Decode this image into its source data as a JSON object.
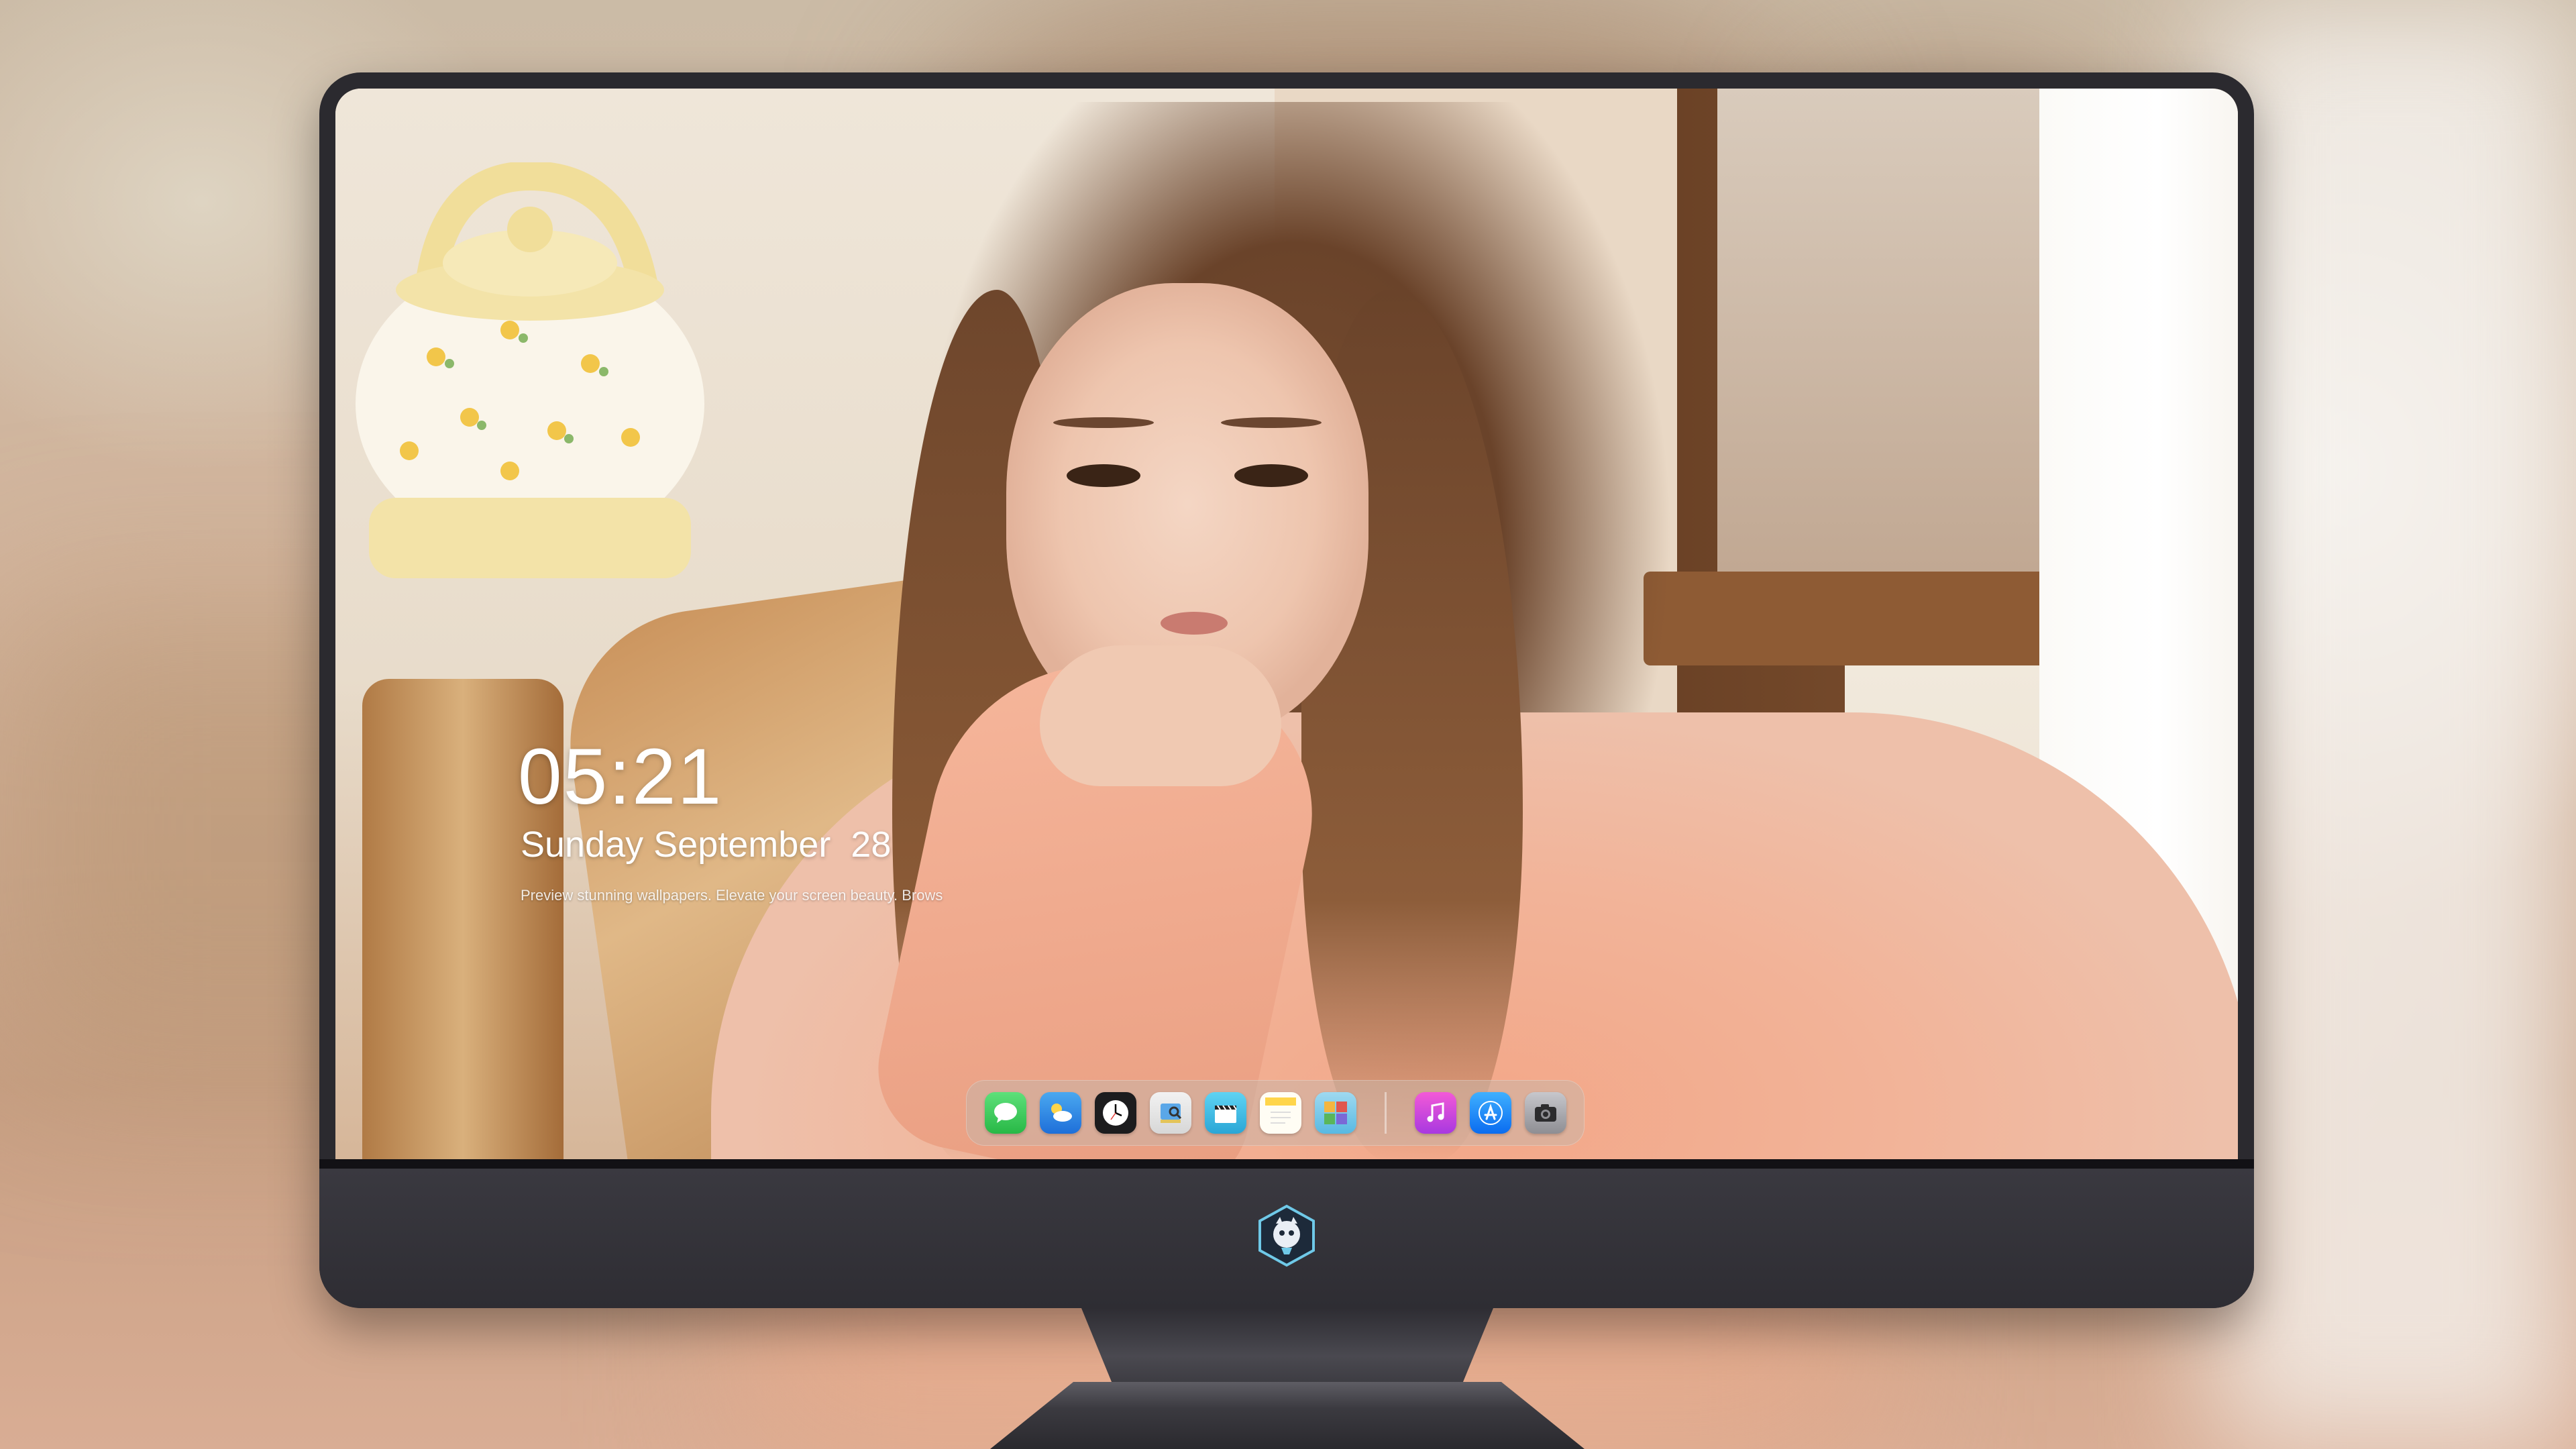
{
  "lock_screen": {
    "time": "05:21",
    "date": "Sunday September  28",
    "caption": "Preview stunning wallpapers. Elevate your screen beauty. Brows"
  },
  "dock": {
    "apps": [
      {
        "name": "Messages",
        "icon": "messages-icon",
        "color": "#34c759"
      },
      {
        "name": "Weather",
        "icon": "weather-icon",
        "color": "#1e88e5"
      },
      {
        "name": "Clock",
        "icon": "clock-icon",
        "color": "#ffffff"
      },
      {
        "name": "Preview",
        "icon": "preview-icon",
        "color": "#e3c45a"
      },
      {
        "name": "Final Cut",
        "icon": "clapperboard-icon",
        "color": "#3bb8e0"
      },
      {
        "name": "Notes",
        "icon": "notes-icon",
        "color": "#ffd54a"
      },
      {
        "name": "Photo Booth",
        "icon": "photos-icon",
        "color": "#6cc3e8"
      },
      {
        "name": "Music",
        "icon": "music-icon",
        "color": "#d94bd9"
      },
      {
        "name": "App Store",
        "icon": "app-store-icon",
        "color": "#1a8cff"
      },
      {
        "name": "Camera",
        "icon": "camera-icon",
        "color": "#8e8e93"
      }
    ]
  },
  "monitor": {
    "bezel_color": "#2b2a2f",
    "logo": "mascot-logo-icon"
  }
}
